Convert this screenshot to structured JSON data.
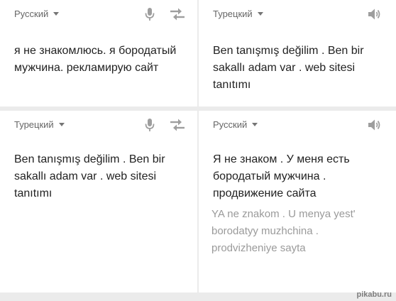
{
  "panels": [
    {
      "language": "Русский",
      "text": "я не знакомлюсь. я бородатый мужчина. рекламирую сайт",
      "icons": [
        "mic-icon",
        "swap-icon"
      ]
    },
    {
      "language": "Турецкий",
      "text": "Ben tanışmış değilim . Ben bir sakallı adam var . web sitesi tanıtımı",
      "icons": [
        "speaker-icon"
      ]
    },
    {
      "language": "Турецкий",
      "text": "Ben tanışmış değilim . Ben bir sakallı adam var . web sitesi tanıtımı",
      "icons": [
        "mic-icon",
        "swap-icon"
      ]
    },
    {
      "language": "Русский",
      "text": "Я не знаком . У меня есть бородатый мужчина . продвижение сайта",
      "transliteration": "YA ne znakom . U menya yest' borodatyy muzhchina . prodvizheniye sayta",
      "icons": [
        "speaker-icon"
      ]
    }
  ],
  "watermark": "pikabu.ru",
  "colors": {
    "background": "#ebebeb",
    "card": "#ffffff",
    "text": "#222222",
    "label": "#666666",
    "icon": "#9e9e9e",
    "transliteration": "#9a9a9a"
  }
}
